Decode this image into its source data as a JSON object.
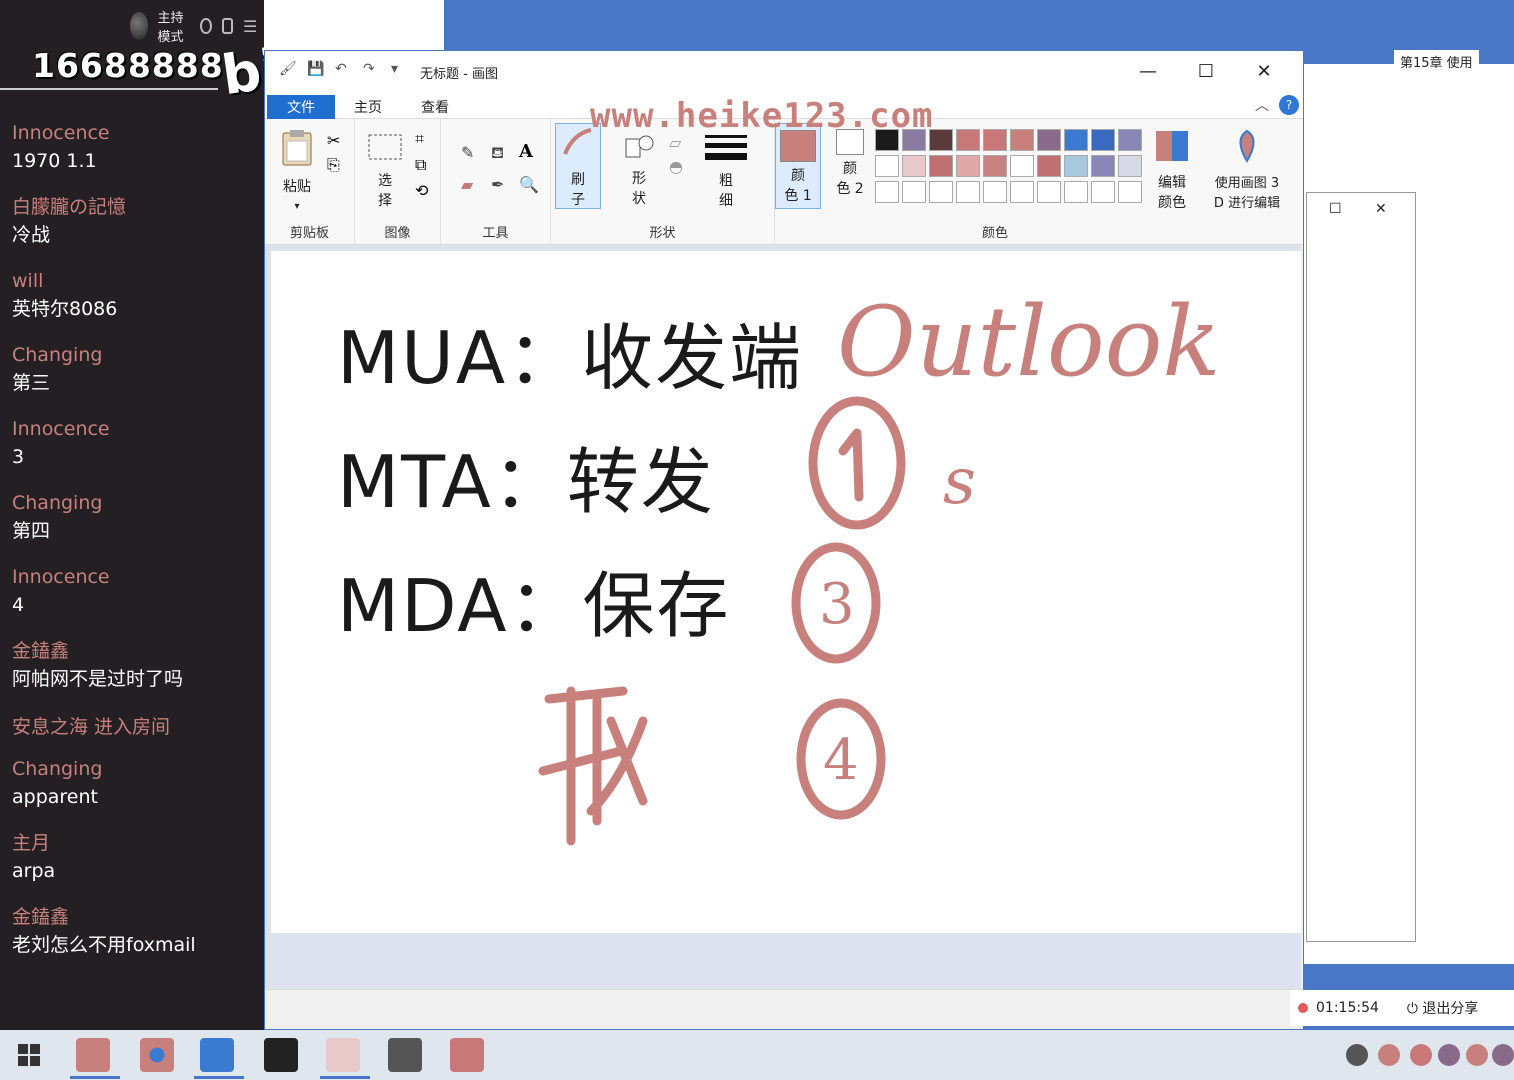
{
  "chat": {
    "host_mode_label": "主持模式",
    "room_id": "16688888",
    "logo_text": "bili",
    "messages": [
      {
        "name": "Innocence",
        "text": "1970 1.1"
      },
      {
        "name": "白朦朧の記憶",
        "text": "冷战"
      },
      {
        "name": "will",
        "text": "英特尔8086"
      },
      {
        "name": "Changing",
        "text": "第三"
      },
      {
        "name": "Innocence",
        "text": "3"
      },
      {
        "name": "Changing",
        "text": "第四"
      },
      {
        "name": "Innocence",
        "text": "4"
      },
      {
        "name": "金鎑鑫",
        "text": "阿帕网不是过时了吗"
      },
      {
        "name": "安息之海 进入房间",
        "text": ""
      },
      {
        "name": "Changing",
        "text": "apparent"
      },
      {
        "name": "主月",
        "text": "arpa"
      },
      {
        "name": "金鎑鑫",
        "text": "老刘怎么不用foxmail"
      }
    ]
  },
  "bg_window": {
    "tab_title": "第15章 使用"
  },
  "paint": {
    "title": "无标题 - 画图",
    "tabs": {
      "file": "文件",
      "home": "主页",
      "view": "查看"
    },
    "help": "?",
    "groups": {
      "clipboard": "剪贴板",
      "image": "图像",
      "tools": "工具",
      "shapes": "形状",
      "colors": "颜色"
    },
    "buttons": {
      "paste": "粘贴",
      "select_1": "选",
      "select_2": "择",
      "brush_1": "刷",
      "brush_2": "子",
      "shape_1": "形",
      "shape_2": "状",
      "size_1": "粗",
      "size_2": "细",
      "color1_1": "颜",
      "color1_2": "色 1",
      "color2_1": "颜",
      "color2_2": "色 2",
      "edit_colors_1": "编辑",
      "edit_colors_2": "颜色",
      "paint3d_1": "使用画图 3",
      "paint3d_2": "D 进行编辑"
    },
    "palette_row1": [
      "#1a1a1a",
      "#8a7ba0",
      "#5a3a3a",
      "#c87878",
      "#c87878",
      "#c8807c",
      "#8a6a8a",
      "#3a7ad0",
      "#3a6ac0",
      "#8a86b8"
    ],
    "palette_row2": [
      "#ffffff",
      "#e8c8c8",
      "#c07070",
      "#e0a8a8",
      "#c88080",
      "#ffffff",
      "#c07070",
      "#a8c8e0",
      "#8a86b8",
      "#d8d8e8"
    ],
    "palette_row3": [
      "#ffffff",
      "#ffffff",
      "#ffffff",
      "#ffffff",
      "#ffffff",
      "#ffffff",
      "#ffffff",
      "#ffffff",
      "#ffffff",
      "#ffffff"
    ],
    "color1": "#c8807c",
    "color2": "#ffffff",
    "canvas_text": {
      "line1": "MUA：收发端",
      "line2": "MTA：转发",
      "line3": "MDA：保存"
    },
    "handwriting": {
      "outlook": "Outlook",
      "circled_1": "1",
      "s": "s",
      "circled_3": "3",
      "circled_4": "4",
      "char": "取"
    },
    "watermark": "www.heike123.com",
    "ink_color": "#c8807c"
  },
  "share_bar": {
    "timer": "01:15:54",
    "exit_label": "退出分享"
  }
}
